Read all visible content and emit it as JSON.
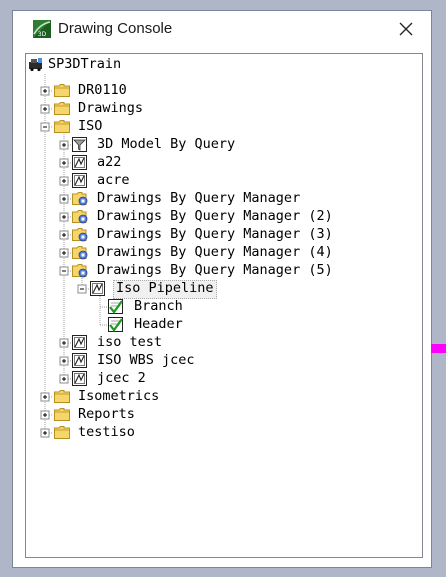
{
  "window": {
    "title": "Drawing Console",
    "close_icon": "close-icon",
    "app_icon": "sp3d-app-icon"
  },
  "tree": {
    "root": {
      "label": "SP3DTrain",
      "icon": "workspace-root-icon"
    },
    "nodes": [
      {
        "id": "dr0110",
        "label": "DR0110",
        "icon": "folder-icon",
        "expander": "+"
      },
      {
        "id": "drawings",
        "label": "Drawings",
        "icon": "folder-icon",
        "expander": "+"
      },
      {
        "id": "iso",
        "label": "ISO",
        "icon": "folder-icon",
        "expander": "-"
      },
      {
        "id": "3d-model-by-query",
        "label": "3D Model By Query",
        "icon": "query-drawing-icon",
        "expander": "+"
      },
      {
        "id": "a22",
        "label": "a22",
        "icon": "drawing-component-icon",
        "expander": "+"
      },
      {
        "id": "acre",
        "label": "acre",
        "icon": "drawing-component-icon",
        "expander": "+"
      },
      {
        "id": "dbqm-1",
        "label": "Drawings By Query Manager",
        "icon": "query-manager-icon",
        "expander": "+"
      },
      {
        "id": "dbqm-2",
        "label": "Drawings By Query Manager (2)",
        "icon": "query-manager-icon",
        "expander": "+"
      },
      {
        "id": "dbqm-3",
        "label": "Drawings By Query Manager (3)",
        "icon": "query-manager-icon",
        "expander": "+"
      },
      {
        "id": "dbqm-4",
        "label": "Drawings By Query Manager (4)",
        "icon": "query-manager-icon",
        "expander": "+"
      },
      {
        "id": "dbqm-5",
        "label": "Drawings By Query Manager (5)",
        "icon": "query-manager-icon",
        "expander": "-"
      },
      {
        "id": "iso-pipeline",
        "label": "Iso Pipeline",
        "icon": "drawing-component-icon",
        "expander": "-"
      },
      {
        "id": "branch",
        "label": "Branch",
        "icon": "checked-drawing-icon",
        "expander": ""
      },
      {
        "id": "header",
        "label": "Header",
        "icon": "checked-drawing-icon",
        "expander": ""
      },
      {
        "id": "iso-test",
        "label": "iso test",
        "icon": "drawing-component-icon",
        "expander": "+"
      },
      {
        "id": "iso-wbs-jcec",
        "label": "ISO WBS jcec",
        "icon": "drawing-component-icon",
        "expander": "+"
      },
      {
        "id": "jcec-2",
        "label": "jcec 2",
        "icon": "drawing-component-icon",
        "expander": "+"
      },
      {
        "id": "isometrics",
        "label": "Isometrics",
        "icon": "folder-icon",
        "expander": "+"
      },
      {
        "id": "reports",
        "label": "Reports",
        "icon": "folder-icon",
        "expander": "+"
      },
      {
        "id": "testiso",
        "label": "testiso",
        "icon": "folder-icon",
        "expander": "+"
      }
    ]
  },
  "colors": {
    "desktop": "#aeb6c8",
    "folder": "#f5d66a",
    "check": "#1a9b1a",
    "tree_line": "#a0a0a0",
    "scroll_marker": "#ff00ff"
  }
}
